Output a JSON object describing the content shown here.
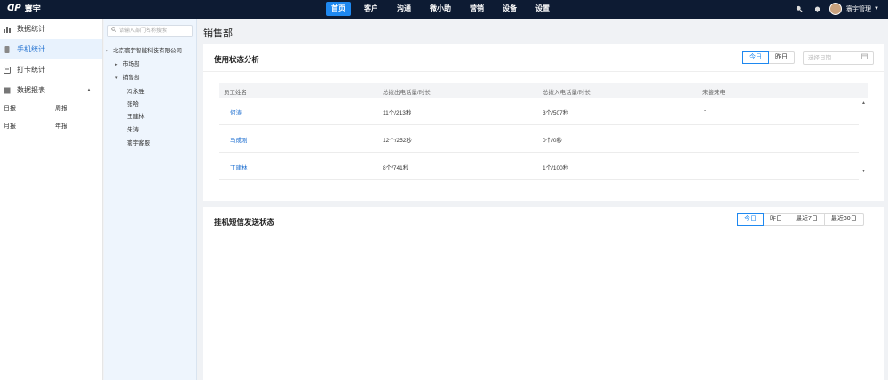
{
  "app": {
    "logo_mark": "ᗡᑭ",
    "brand": "寰宇"
  },
  "nav": {
    "items": [
      "首页",
      "客户",
      "沟通",
      "微小助",
      "营销",
      "设备",
      "设置"
    ],
    "active_index": 0
  },
  "header_right": {
    "username": "寰宇管理"
  },
  "sidebar": {
    "items": [
      {
        "label": "数据统计",
        "icon": "bar-chart-icon"
      },
      {
        "label": "手机统计",
        "icon": "phone-icon",
        "active": true
      },
      {
        "label": "打卡统计",
        "icon": "clock-in-icon"
      },
      {
        "label": "数据报表",
        "icon": "report-icon",
        "arrow": "▲"
      }
    ],
    "sub_items": [
      "日报",
      "周报",
      "月报",
      "年报"
    ]
  },
  "tree": {
    "search_placeholder": "请输入部门名称搜索",
    "nodes": [
      {
        "label": "北京寰宇智能科技有限公司",
        "toggle": "▾"
      },
      {
        "label": "市场部",
        "toggle": "▸"
      },
      {
        "label": "销售部",
        "toggle": "▾"
      },
      {
        "label": "冯永胜",
        "toggle": ""
      },
      {
        "label": "张哈",
        "toggle": ""
      },
      {
        "label": "王建林",
        "toggle": ""
      },
      {
        "label": "朱涛",
        "toggle": ""
      },
      {
        "label": "寰宇客服",
        "toggle": ""
      }
    ]
  },
  "page": {
    "title": "销售部"
  },
  "usage_card": {
    "title": "使用状态分析",
    "range_buttons": [
      "今日",
      "昨日"
    ],
    "active_range": 0,
    "date_placeholder": "选择日期",
    "columns": [
      "员工姓名",
      "总拨出电话量/时长",
      "总拨入电话量/时长",
      "未接来电"
    ],
    "rows": [
      {
        "name": "何涛",
        "outgoing": "11个/213秒",
        "incoming": "3个/507秒",
        "missed": "-"
      },
      {
        "name": "马成刚",
        "outgoing": "12个/252秒",
        "incoming": "0个/0秒",
        "missed": ""
      },
      {
        "name": "丁建林",
        "outgoing": "8个/741秒",
        "incoming": "1个/100秒",
        "missed": ""
      }
    ]
  },
  "sms_card": {
    "title": "挂机短信发送状态",
    "range_buttons": [
      "今日",
      "昨日",
      "最近7日",
      "最近30日"
    ],
    "active_range": 0
  }
}
